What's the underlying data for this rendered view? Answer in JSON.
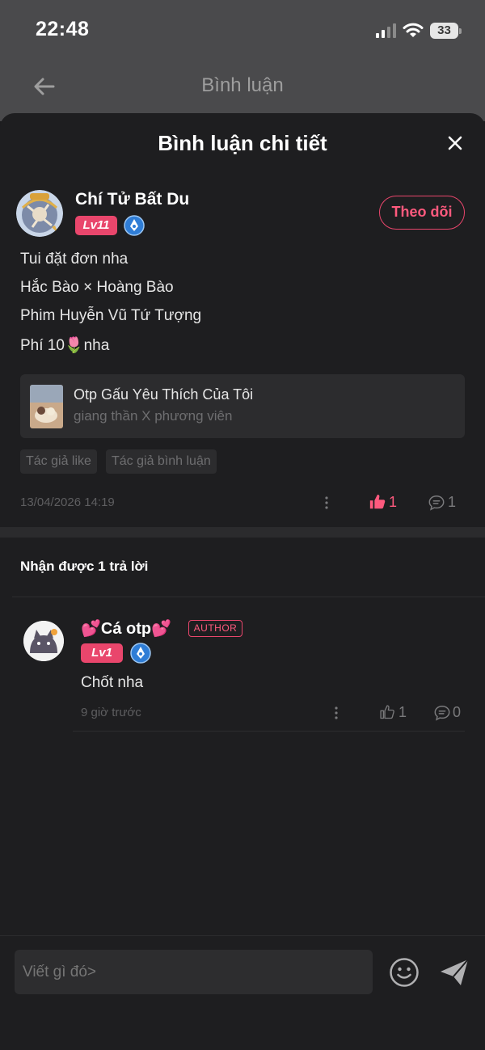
{
  "status": {
    "time": "22:48",
    "battery": "33"
  },
  "nav": {
    "title": "Bình luận"
  },
  "sheet": {
    "title": "Bình luận chi tiết"
  },
  "comment": {
    "username": "Chí Tử Bất Du",
    "level": "Lv11",
    "follow_label": "Theo dõi",
    "lines": [
      "Tui đặt đơn nha",
      "Hắc Bào × Hoàng Bào",
      "Phim Huyễn Vũ Tứ Tượng",
      "Phí 10🌷nha"
    ],
    "book": {
      "title": "Otp Gấu Yêu Thích Của Tôi",
      "subtitle": "giang thần X phương viên"
    },
    "tags": [
      "Tác giả like",
      "Tác giả bình luận"
    ],
    "date": "13/04/2026 14:19",
    "likes": "1",
    "comments": "1"
  },
  "replies_header": "Nhận được 1 trả lời",
  "reply": {
    "username": "💕Cá otp💕",
    "author_tag": "AUTHOR",
    "level": "Lv1",
    "text": "Chốt nha",
    "time": "9 giờ trước",
    "likes": "1",
    "comments": "0"
  },
  "input": {
    "placeholder": "Viết gì đó>"
  },
  "colors": {
    "accent": "#e9466c",
    "background": "#1e1e20",
    "card": "#2c2c2e"
  },
  "icons": [
    "back-arrow-icon",
    "close-icon",
    "pen-icon",
    "more-icon",
    "thumbs-up-icon",
    "comment-icon",
    "emoji-icon",
    "send-icon"
  ]
}
